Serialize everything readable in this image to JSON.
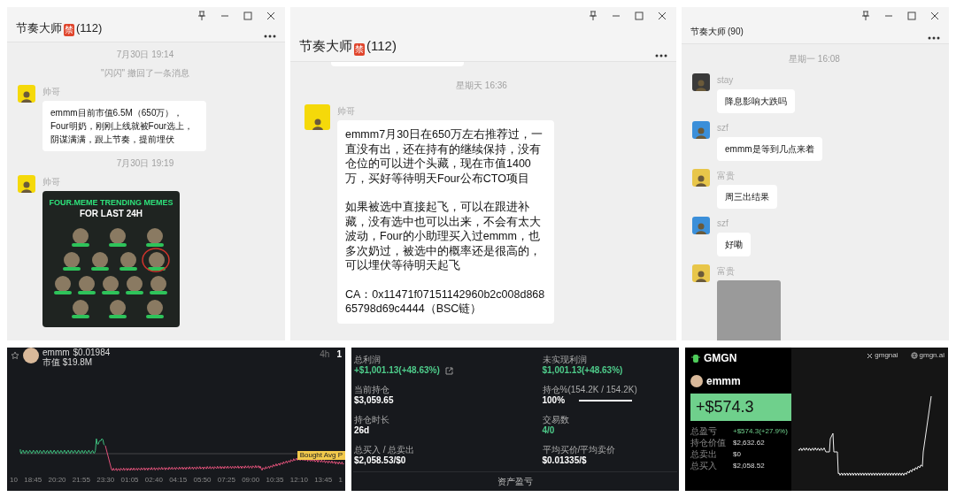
{
  "chat_windows": [
    {
      "title": "节奏大师",
      "badge": "禁",
      "count": "(112)",
      "messages": [
        {
          "kind": "time",
          "text": "7月30日 19:14"
        },
        {
          "kind": "notice",
          "text": "\"闪闪\" 撤回了一条消息"
        },
        {
          "kind": "text",
          "sender": "帅哥",
          "color": "#f5d90a",
          "text": "emmm目前市值6.5M（650万），Four明奶，刚刚上线就被Four选上，阴谋满满，跟上节奏，提前埋伏"
        },
        {
          "kind": "time",
          "text": "7月30日 19:19"
        },
        {
          "kind": "image",
          "sender": "帅哥",
          "color": "#f5d90a",
          "title": "FOUR.MEME TRENDING MEMES",
          "subtitle": "FOR LAST 24H"
        }
      ]
    },
    {
      "title": "节奏大师",
      "badge": "禁",
      "count": "(112)",
      "messages": [
        {
          "kind": "cut"
        },
        {
          "kind": "time",
          "text": "星期天 16:36"
        },
        {
          "kind": "text",
          "sender": "帅哥",
          "color": "#f5d90a",
          "paragraphs": [
            "emmm7月30日在650万左右推荐过，一直没有出，还在持有的继续保持，没有仓位的可以进个头藏，现在市值1400万，买好等待明天Four公布CTO项目",
            "如果被选中直接起飞，可以在跟进补藏，没有选中也可以出来，不会有太大波动，Four的小助理买入过emmm，也多次奶过，被选中的概率还是很高的，可以埋伏等待明天起飞",
            "CA：0x11471f07151142960b2c008d86865798d69c4444（BSC链）"
          ]
        }
      ]
    },
    {
      "title": "节奏大师",
      "count": "(90)",
      "messages": [
        {
          "kind": "cut"
        },
        {
          "kind": "time",
          "text": "星期一 16:08"
        },
        {
          "kind": "text",
          "sender": "stay",
          "color": "#3a3a3a",
          "text": "降息影响大跌吗"
        },
        {
          "kind": "text",
          "sender": "szf",
          "color": "#3b8fd9",
          "text": "emmm是等到几点来着"
        },
        {
          "kind": "text",
          "sender": "富贵",
          "color": "#e8c64a",
          "text": "周三出结果"
        },
        {
          "kind": "text",
          "sender": "szf",
          "color": "#3b8fd9",
          "text": "好嘞"
        },
        {
          "kind": "screenshot",
          "sender": "富贵",
          "color": "#e8c64a"
        }
      ]
    }
  ],
  "price_chart": {
    "token": "emmm",
    "price": "$0.01984",
    "market_cap": "市值 $19.8M",
    "intervals": [
      {
        "label": "4h",
        "selected": false
      },
      {
        "label": "1",
        "selected": true
      }
    ],
    "avg_label": "Bought Avg P",
    "x_ticks": [
      "10",
      "18:45",
      "20:20",
      "21:55",
      "23:30",
      "01:05",
      "02:40",
      "04:15",
      "05:50",
      "07:25",
      "09:00",
      "10:35",
      "12:10",
      "13:45",
      "1"
    ]
  },
  "position_stats": {
    "items": [
      {
        "label": "总利润",
        "value": "+$1,001.13(+48.63%)",
        "positive": true,
        "link": true
      },
      {
        "label": "未实现利润",
        "value": "$1,001.13(+48.63%)",
        "positive": true
      },
      {
        "label": "当前持仓",
        "value": "$3,059.65",
        "positive": false
      },
      {
        "label": "持仓%(154.2K / 154.2K)",
        "value": "100%",
        "positive": false,
        "level": 1
      },
      {
        "label": "持仓时长",
        "value": "26d",
        "positive": false
      },
      {
        "label": "交易数",
        "value": "4/0",
        "positive": true
      },
      {
        "label": "总买入 / 总卖出",
        "value": "$2,058.53/$0",
        "positive": false
      },
      {
        "label": "平均买价/平均卖价",
        "value": "$0.01335/$",
        "positive": false
      }
    ],
    "footer": "资产盈亏"
  },
  "pnl_card": {
    "brand": "GMGN",
    "links": [
      "gmgnai",
      "gmgn.ai"
    ],
    "user": "emmm",
    "pnl": "+$574.3",
    "rows": [
      {
        "label": "总盈亏",
        "value": "+$574.3(+27.9%)",
        "positive": true
      },
      {
        "label": "持仓价值",
        "value": "$2,632.62",
        "positive": false
      },
      {
        "label": "总卖出",
        "value": "$0",
        "positive": false
      },
      {
        "label": "总买入",
        "value": "$2,058.52",
        "positive": false
      }
    ]
  }
}
